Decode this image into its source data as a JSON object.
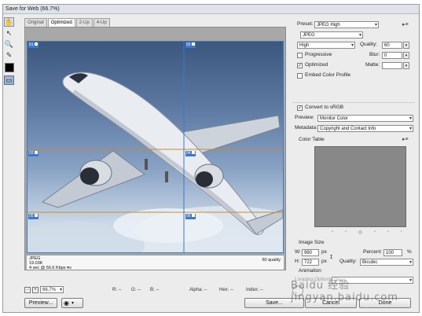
{
  "window": {
    "title": "Save for Web (66.7%)"
  },
  "tools": [
    "hand-icon",
    "slice-select-icon",
    "zoom-icon",
    "eyedropper-icon",
    "color-swatch",
    "slice-visibility-icon"
  ],
  "tabs": [
    "Original",
    "Optimized",
    "2-Up",
    "4-Up"
  ],
  "active_tab": "Optimized",
  "slices": [
    "01",
    "02",
    "03",
    "04",
    "05",
    "06"
  ],
  "image_info": {
    "format": "JPEG",
    "size": "19.03K",
    "time": "4 sec @ 56.6 Kbps",
    "time_menu": "▾≡",
    "quality": "60 quality"
  },
  "status": {
    "zoom": "66.7%",
    "r": "R: --",
    "g": "G: --",
    "b": "B: --",
    "alpha": "Alpha: --",
    "hex": "Hex: --",
    "index": "Index: --"
  },
  "buttons": {
    "preview": "Preview...",
    "save": "Save...",
    "cancel": "Cancel",
    "done": "Done"
  },
  "settings": {
    "preset_label": "Preset:",
    "preset_value": "JPEG High",
    "format_value": "JPEG",
    "compression_value": "High",
    "quality_label": "Quality:",
    "quality_value": "60",
    "progressive_label": "Progressive",
    "progressive_checked": false,
    "blur_label": "Blur:",
    "blur_value": "0",
    "optimized_label": "Optimized",
    "optimized_checked": true,
    "matte_label": "Matte:",
    "embed_profile_label": "Embed Color Profile",
    "embed_profile_checked": false,
    "convert_srgb_label": "Convert to sRGB",
    "convert_srgb_checked": true,
    "preview_label": "Preview:",
    "preview_value": "Monitor Color",
    "metadata_label": "Metadata:",
    "metadata_value": "Copyright and Contact Info"
  },
  "color_table": {
    "title": "Color Table"
  },
  "image_size": {
    "title": "Image Size",
    "w_label": "W:",
    "w_value": "960",
    "h_label": "H:",
    "h_value": "722",
    "unit": "px",
    "percent_label": "Percent:",
    "percent_value": "100",
    "percent_unit": "%",
    "quality_label": "Quality:",
    "quality_value": "Bicubic"
  },
  "animation": {
    "title": "Animation",
    "looping_label": "Looping Options:",
    "looping_value": "Once"
  },
  "watermark": "Baidu 经验 jingyan.baidu.com",
  "colors": {
    "slice_blue": "#3d78c9",
    "slice_line": "#c98a2a",
    "window_bg": "#ececec"
  }
}
